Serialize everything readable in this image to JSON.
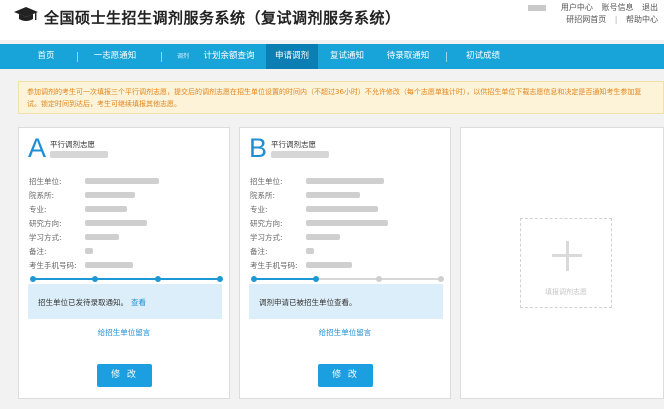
{
  "header": {
    "title": "全国硕士生招生调剂服务系统（复试调剂服务系统）",
    "user_links": [
      "用户中心",
      "账号信息",
      "退出"
    ],
    "links_row2": [
      "研招网首页",
      "帮助中心"
    ]
  },
  "nav": {
    "items": [
      {
        "label": "首页",
        "active": false
      },
      {
        "label": "一志愿通知",
        "active": false
      },
      {
        "label": "计划余额查询",
        "active": false
      },
      {
        "label": "申请调剂",
        "active": true
      },
      {
        "label": "复试通知",
        "active": false
      },
      {
        "label": "待录取通知",
        "active": false
      },
      {
        "label": "初试成绩",
        "active": false
      }
    ],
    "prefix_label": "调剂"
  },
  "notice": {
    "text": "参加调剂的考生可一次填报三个平行调剂志愿，提交后的调剂志愿在招生单位设置的时间内（不超过36小时）不允许修改（每个志愿单独计时），以供招生单位下载志愿信息和决定是否通知考生参加复试。锁定时间到达后，考生可继续填报其他志愿。"
  },
  "field_labels": [
    "招生单位:",
    "院系所:",
    "专业:",
    "研究方向:",
    "学习方式:",
    "备注:",
    "考生手机号码:"
  ],
  "cards": [
    {
      "letter": "A",
      "type_label": "平行调剂志愿",
      "progress_value": 1.0,
      "status_text": "招生单位已发待录取通知。",
      "status_link": "查看",
      "message_link": "给招生单位留言",
      "edit_label": "修 改"
    },
    {
      "letter": "B",
      "type_label": "平行调剂志愿",
      "progress_value": 0.33,
      "status_text": "调剂申请已被招生单位查看。",
      "status_link": "",
      "message_link": "给招生单位留言",
      "edit_label": "修 改"
    }
  ],
  "add_card": {
    "label": "填报调剂志愿",
    "icon": "plus-icon"
  },
  "colors": {
    "nav_bg": "#18a4d8",
    "nav_active": "#0b7fb3",
    "accent": "#1c8fd6",
    "notice_text": "#e0851e",
    "notice_bg": "#fdf3d8",
    "status_bg": "#dceef9"
  }
}
